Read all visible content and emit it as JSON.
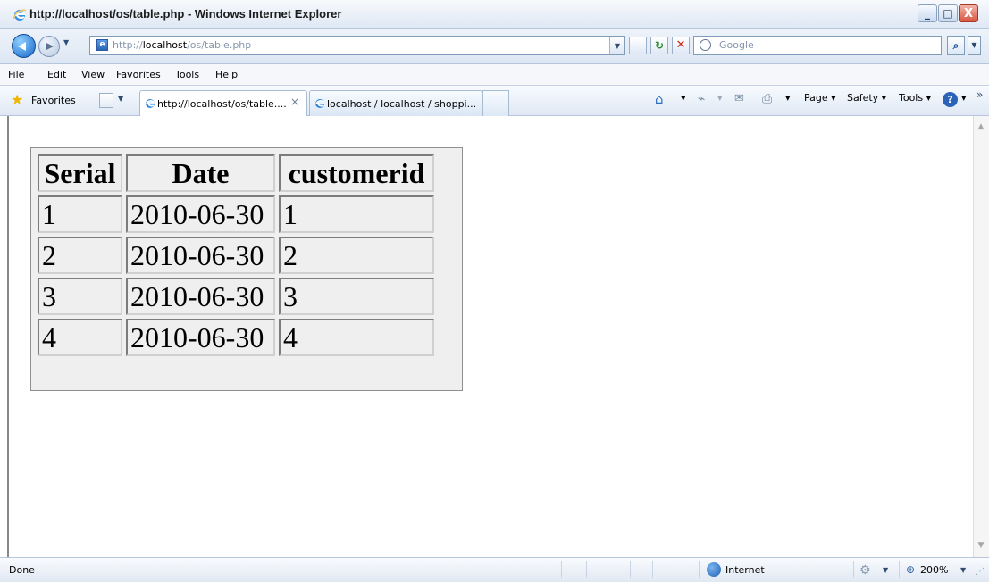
{
  "window": {
    "title": "http://localhost/os/table.php - Windows Internet Explorer",
    "controls": {
      "minimize": "_",
      "maximize": "□",
      "close": "X"
    }
  },
  "nav": {
    "address_prefix": "http://",
    "address_host": "localhost",
    "address_path": "/os/table.php",
    "search_placeholder": "Google"
  },
  "menu": {
    "items": [
      "File",
      "Edit",
      "View",
      "Favorites",
      "Tools",
      "Help"
    ]
  },
  "favorites": {
    "label": "Favorites",
    "tabs": [
      {
        "label": "http://localhost/os/table....",
        "active": true
      },
      {
        "label": "localhost / localhost / shoppi...",
        "active": false
      }
    ],
    "commands": {
      "page": "Page",
      "safety": "Safety",
      "tools": "Tools"
    }
  },
  "table": {
    "headers": [
      "Serial",
      "Date",
      "customerid"
    ],
    "rows": [
      [
        "1",
        "2010-06-30",
        "1"
      ],
      [
        "2",
        "2010-06-30",
        "2"
      ],
      [
        "3",
        "2010-06-30",
        "3"
      ],
      [
        "4",
        "2010-06-30",
        "4"
      ]
    ]
  },
  "status": {
    "left": "Done",
    "zone": "Internet",
    "zoom": "200%"
  },
  "icons": {
    "browser": "ie-logo-icon",
    "back": "back-arrow-icon",
    "forward": "forward-arrow-icon",
    "refresh": "refresh-icon",
    "stop": "stop-icon",
    "search": "search-icon",
    "favorites": "star-icon",
    "home": "home-icon",
    "feeds": "rss-icon",
    "mail": "mail-icon",
    "print": "printer-icon",
    "help": "help-icon",
    "zone": "globe-icon",
    "zoom": "zoom-icon"
  }
}
